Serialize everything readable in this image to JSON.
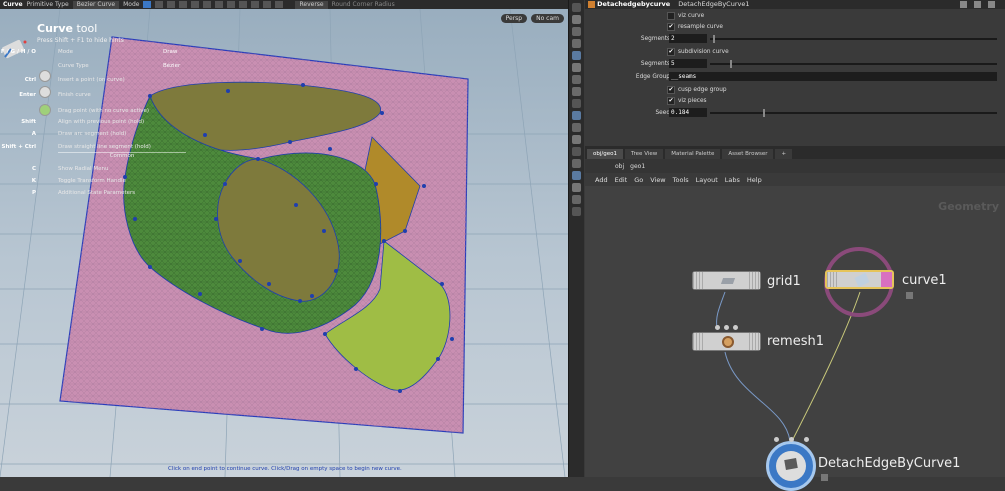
{
  "viewport": {
    "topbar": {
      "tool": "Curve",
      "primitive_type_label": "Primitive Type",
      "primitive_type_value": "Bezier Curve",
      "mode_label": "Mode",
      "reverse_label": "Reverse",
      "round_corner_label": "Round Corner Radius"
    },
    "view_buttons": [
      "Persp",
      "No cam"
    ],
    "hud": {
      "title_bold": "Curve",
      "title_rest": " tool",
      "hint": "Press Shift + F1 to hide hints",
      "rows": [
        {
          "key": "F / G / H / O",
          "label": "Mode",
          "value": "Draw"
        },
        {
          "key": "",
          "label": "Curve Type",
          "value": "Bézier"
        },
        {
          "key": "Ctrl",
          "label": "Insert a point (on curve)",
          "value": ""
        },
        {
          "key": "Enter",
          "label": "Finish curve",
          "value": ""
        },
        {
          "key": "",
          "label": "Drag point (with no curve active)",
          "value": ""
        },
        {
          "key": "Shift",
          "label": "Align with previous point (hold)",
          "value": ""
        },
        {
          "key": "A",
          "label": "Draw arc segment (hold)",
          "value": ""
        },
        {
          "key": "Shift + Ctrl",
          "label": "Draw straight line segment (hold)",
          "value": ""
        },
        {
          "key": "C",
          "label": "Show Radial Menu",
          "value": ""
        },
        {
          "key": "K",
          "label": "Toggle Transform Handle",
          "value": ""
        },
        {
          "key": "P",
          "label": "Additional State Parameters",
          "value": ""
        }
      ],
      "section_common": "Common"
    },
    "status": "Click on end point to continue curve. Click/Drag on empty space to begin new curve."
  },
  "params": {
    "node_type": "Detachedgebycurve",
    "node_name": "DetachEdgeByCurve1",
    "rows": [
      {
        "kind": "check",
        "label": "",
        "text": "viz curve",
        "checked": false
      },
      {
        "kind": "check",
        "label": "",
        "text": "resample curve",
        "checked": true
      },
      {
        "kind": "slider",
        "label": "Segments",
        "value": "2",
        "frac": 0.01
      },
      {
        "kind": "check",
        "label": "",
        "text": "subdivision curve",
        "checked": true
      },
      {
        "kind": "slider",
        "label": "Segments",
        "value": "5",
        "frac": 0.07
      },
      {
        "kind": "text",
        "label": "Edge Group",
        "value": "__seams"
      },
      {
        "kind": "check",
        "label": "",
        "text": "cusp edge group",
        "checked": true
      },
      {
        "kind": "check",
        "label": "",
        "text": "viz pieces",
        "checked": true
      },
      {
        "kind": "slider",
        "label": "Seed",
        "value": "0.184",
        "frac": 0.184
      }
    ]
  },
  "network": {
    "tabs": [
      "obj/geo1",
      "Tree View",
      "Material Palette",
      "Asset Browser"
    ],
    "path": [
      "obj",
      "geo1"
    ],
    "menu": [
      "Add",
      "Edit",
      "Go",
      "View",
      "Tools",
      "Layout",
      "Labs",
      "Help"
    ],
    "context_label": "Geometry",
    "nodes": {
      "grid": "grid1",
      "remesh": "remesh1",
      "curve": "curve1",
      "detach": "DetachEdgeByCurve1"
    }
  },
  "colors": {
    "mesh_pink": "#c98fb2",
    "piece_green": "#4d8a3c",
    "piece_olive": "#7e7a3c",
    "piece_orange": "#b08a2a",
    "piece_lime": "#9fbd45",
    "curve_blue": "#1f3fae",
    "selected_node": "#e6c45a",
    "curve_node_ring": "#8a4a7a"
  }
}
